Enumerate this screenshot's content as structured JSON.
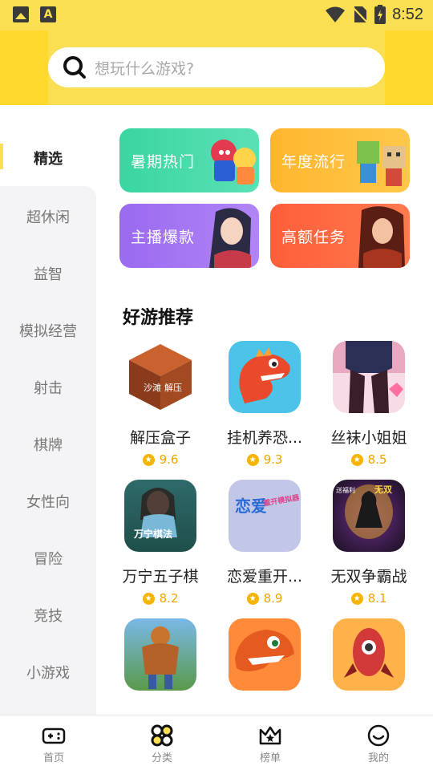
{
  "status_bar": {
    "time": "8:52",
    "icons": [
      "image-icon",
      "font-icon",
      "wifi-icon",
      "no-sim-icon",
      "battery-icon"
    ]
  },
  "search": {
    "placeholder": "想玩什么游戏?"
  },
  "sidebar": {
    "active": "精选",
    "items": [
      "超休闲",
      "益智",
      "模拟经营",
      "射击",
      "棋牌",
      "女性向",
      "冒险",
      "竞技",
      "小游戏"
    ]
  },
  "banners": [
    {
      "label": "暑期热门",
      "color": "#3ad6a0"
    },
    {
      "label": "年度流行",
      "color": "#ffb62e"
    },
    {
      "label": "主播爆款",
      "color": "#a070f0"
    },
    {
      "label": "高额任务",
      "color": "#ff6a45"
    }
  ],
  "section": {
    "title": "好游推荐"
  },
  "games": [
    {
      "name": "解压盒子",
      "rating": "9.6"
    },
    {
      "name": "挂机养恐...",
      "rating": "9.3"
    },
    {
      "name": "丝袜小姐姐",
      "rating": "8.5"
    },
    {
      "name": "万宁五子棋",
      "rating": "8.2"
    },
    {
      "name": "恋爱重开...",
      "rating": "8.9"
    },
    {
      "name": "无双争霸战",
      "rating": "8.1"
    },
    {
      "name": "",
      "rating": ""
    },
    {
      "name": "",
      "rating": ""
    },
    {
      "name": "",
      "rating": ""
    }
  ],
  "icon_text": {
    "box_left": "沙滩",
    "box_right": "解压",
    "wanning": "万宁棋法",
    "love": "恋爱",
    "love_sub": "重开模拟器",
    "wushuang": "无双",
    "wushuang_small": "送福利"
  },
  "bottom_nav": [
    {
      "label": "首页",
      "icon": "gamepad-icon"
    },
    {
      "label": "分类",
      "icon": "grid-icon"
    },
    {
      "label": "榜单",
      "icon": "crown-icon"
    },
    {
      "label": "我的",
      "icon": "smile-icon"
    }
  ],
  "colors": {
    "brand_yellow": "#fadf52",
    "rating_gold": "#f5b400"
  }
}
